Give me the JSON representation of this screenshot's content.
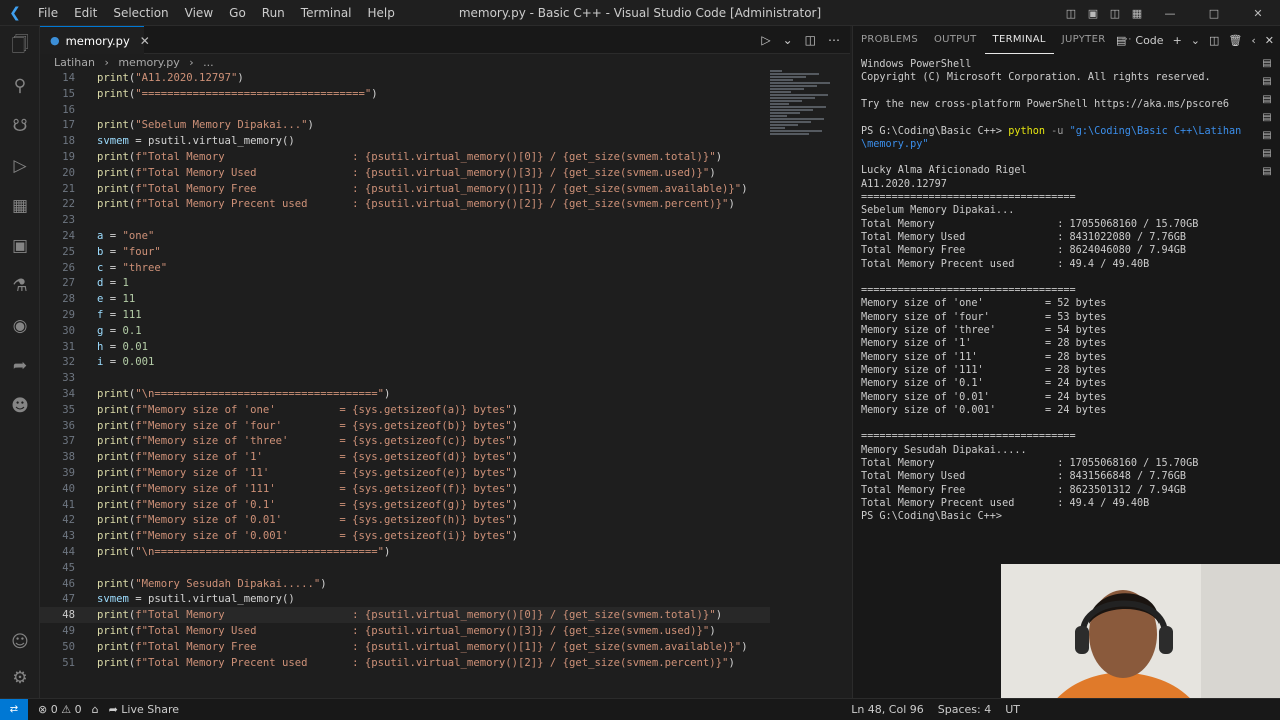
{
  "window": {
    "title": "memory.py - Basic C++ - Visual Studio Code [Administrator]",
    "menu": [
      "File",
      "Edit",
      "Selection",
      "View",
      "Go",
      "Run",
      "Terminal",
      "Help"
    ]
  },
  "editor": {
    "tab_label": "memory.py",
    "breadcrumb": [
      "Latihan",
      "memory.py",
      "..."
    ],
    "current_line": 48,
    "lines": [
      {
        "n": "14",
        "t": "print(\"A11.2020.12797\")"
      },
      {
        "n": "15",
        "t": "print(\"===================================\")"
      },
      {
        "n": "16",
        "t": ""
      },
      {
        "n": "17",
        "t": "print(\"Sebelum Memory Dipakai...\")"
      },
      {
        "n": "18",
        "t": "svmem = psutil.virtual_memory()"
      },
      {
        "n": "19",
        "t": "print(f\"Total Memory                    : {psutil.virtual_memory()[0]} / {get_size(svmem.total)}\")"
      },
      {
        "n": "20",
        "t": "print(f\"Total Memory Used               : {psutil.virtual_memory()[3]} / {get_size(svmem.used)}\")"
      },
      {
        "n": "21",
        "t": "print(f\"Total Memory Free               : {psutil.virtual_memory()[1]} / {get_size(svmem.available)}\")"
      },
      {
        "n": "22",
        "t": "print(f\"Total Memory Precent used       : {psutil.virtual_memory()[2]} / {get_size(svmem.percent)}\")"
      },
      {
        "n": "23",
        "t": ""
      },
      {
        "n": "24",
        "t": "a = \"one\""
      },
      {
        "n": "25",
        "t": "b = \"four\""
      },
      {
        "n": "26",
        "t": "c = \"three\""
      },
      {
        "n": "27",
        "t": "d = 1"
      },
      {
        "n": "28",
        "t": "e = 11"
      },
      {
        "n": "29",
        "t": "f = 111"
      },
      {
        "n": "30",
        "t": "g = 0.1"
      },
      {
        "n": "31",
        "t": "h = 0.01"
      },
      {
        "n": "32",
        "t": "i = 0.001"
      },
      {
        "n": "33",
        "t": ""
      },
      {
        "n": "34",
        "t": "print(\"\\n===================================\")"
      },
      {
        "n": "35",
        "t": "print(f\"Memory size of 'one'          = {sys.getsizeof(a)} bytes\")"
      },
      {
        "n": "36",
        "t": "print(f\"Memory size of 'four'         = {sys.getsizeof(b)} bytes\")"
      },
      {
        "n": "37",
        "t": "print(f\"Memory size of 'three'        = {sys.getsizeof(c)} bytes\")"
      },
      {
        "n": "38",
        "t": "print(f\"Memory size of '1'            = {sys.getsizeof(d)} bytes\")"
      },
      {
        "n": "39",
        "t": "print(f\"Memory size of '11'           = {sys.getsizeof(e)} bytes\")"
      },
      {
        "n": "40",
        "t": "print(f\"Memory size of '111'          = {sys.getsizeof(f)} bytes\")"
      },
      {
        "n": "41",
        "t": "print(f\"Memory size of '0.1'          = {sys.getsizeof(g)} bytes\")"
      },
      {
        "n": "42",
        "t": "print(f\"Memory size of '0.01'         = {sys.getsizeof(h)} bytes\")"
      },
      {
        "n": "43",
        "t": "print(f\"Memory size of '0.001'        = {sys.getsizeof(i)} bytes\")"
      },
      {
        "n": "44",
        "t": "print(\"\\n===================================\")"
      },
      {
        "n": "45",
        "t": ""
      },
      {
        "n": "46",
        "t": "print(\"Memory Sesudah Dipakai.....\")"
      },
      {
        "n": "47",
        "t": "svmem = psutil.virtual_memory()"
      },
      {
        "n": "48",
        "t": "print(f\"Total Memory                    : {psutil.virtual_memory()[0]} / {get_size(svmem.total)}\")"
      },
      {
        "n": "49",
        "t": "print(f\"Total Memory Used               : {psutil.virtual_memory()[3]} / {get_size(svmem.used)}\")"
      },
      {
        "n": "50",
        "t": "print(f\"Total Memory Free               : {psutil.virtual_memory()[1]} / {get_size(svmem.available)}\")"
      },
      {
        "n": "51",
        "t": "print(f\"Total Memory Precent used       : {psutil.virtual_memory()[2]} / {get_size(svmem.percent)}\")"
      }
    ]
  },
  "panel": {
    "tabs": [
      "PROBLEMS",
      "OUTPUT",
      "TERMINAL",
      "JUPYTER"
    ],
    "active_tab": "TERMINAL",
    "shell_label": "Code",
    "terminal_lines": [
      "Windows PowerShell",
      "Copyright (C) Microsoft Corporation. All rights reserved.",
      "",
      "Try the new cross-platform PowerShell https://aka.ms/pscore6",
      "",
      "PS G:\\Coding\\Basic C++> python -u \"g:\\Coding\\Basic C++\\Latihan",
      "\\memory.py\"",
      "",
      "Lucky Alma Aficionado Rigel",
      "A11.2020.12797",
      "===================================",
      "Sebelum Memory Dipakai...",
      "Total Memory                    : 17055068160 / 15.70GB",
      "Total Memory Used               : 8431022080 / 7.76GB",
      "Total Memory Free               : 8624046080 / 7.94GB",
      "Total Memory Precent used       : 49.4 / 49.40B",
      "",
      "===================================",
      "Memory size of 'one'          = 52 bytes",
      "Memory size of 'four'         = 53 bytes",
      "Memory size of 'three'        = 54 bytes",
      "Memory size of '1'            = 28 bytes",
      "Memory size of '11'           = 28 bytes",
      "Memory size of '111'          = 28 bytes",
      "Memory size of '0.1'          = 24 bytes",
      "Memory size of '0.01'         = 24 bytes",
      "Memory size of '0.001'        = 24 bytes",
      "",
      "===================================",
      "Memory Sesudah Dipakai.....",
      "Total Memory                    : 17055068160 / 15.70GB",
      "Total Memory Used               : 8431566848 / 7.76GB",
      "Total Memory Free               : 8623501312 / 7.94GB",
      "Total Memory Precent used       : 49.4 / 49.40B",
      "PS G:\\Coding\\Basic C++>"
    ]
  },
  "status": {
    "errors": "0",
    "warnings": "0",
    "live_share": "Live Share",
    "cursor": "Ln 48, Col 96",
    "spaces": "Spaces: 4",
    "encoding": "UT"
  },
  "colors": {
    "accent": "#0078d4",
    "string": "#ce9178",
    "function": "#dcdcaa",
    "number": "#b5cea8"
  }
}
